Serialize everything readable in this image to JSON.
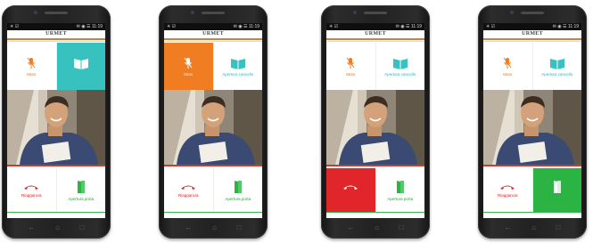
{
  "status": {
    "left": "✳ ☑",
    "right": "✉ ◉ ☰ 11:19"
  },
  "app": {
    "brand": "URMET"
  },
  "labels": {
    "mute": "Muto",
    "door": "Apertura cancello",
    "hangup": "Riaggancia",
    "open": "Apertura porta"
  },
  "colors": {
    "teal": "#37c2bf",
    "orange": "#f07d22",
    "red": "#e0262b",
    "green": "#2bb443"
  },
  "icons": {
    "mute": "mic-off-icon",
    "door": "gate-icon",
    "hangup": "hangup-icon",
    "open": "door-icon"
  },
  "nav": [
    "←",
    "⌂",
    "□"
  ],
  "phones": [
    {
      "highlight": "door"
    },
    {
      "highlight": "mute"
    },
    {
      "highlight": "hangup"
    },
    {
      "highlight": "open"
    }
  ]
}
